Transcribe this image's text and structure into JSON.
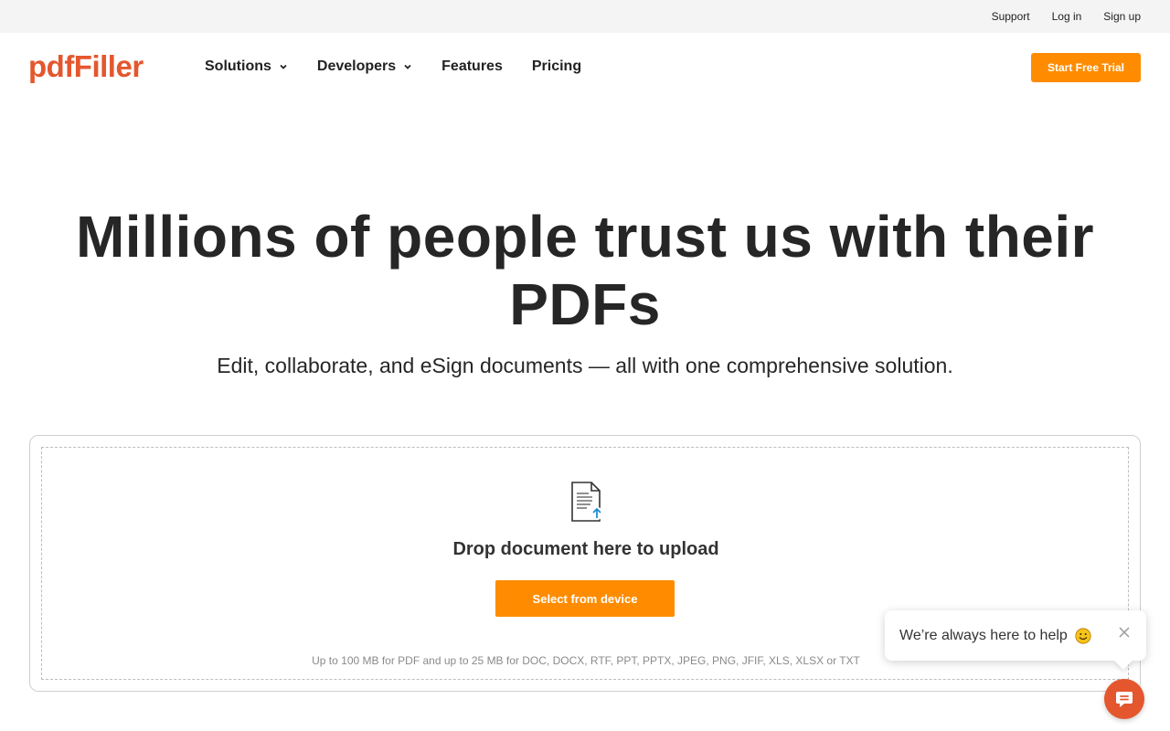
{
  "topbar": {
    "links": [
      "Support",
      "Log in",
      "Sign up"
    ]
  },
  "nav": {
    "logo": "pdfFiller",
    "items": [
      {
        "label": "Solutions",
        "has_dropdown": true
      },
      {
        "label": "Developers",
        "has_dropdown": true
      },
      {
        "label": "Features",
        "has_dropdown": false
      },
      {
        "label": "Pricing",
        "has_dropdown": false
      }
    ],
    "cta_label": "Start Free Trial"
  },
  "hero": {
    "title": "Millions of people trust us with their PDFs",
    "subtitle": "Edit, collaborate, and eSign documents — all with one comprehensive solution."
  },
  "upload": {
    "icon": "document-upload-icon",
    "title": "Drop document here to upload",
    "button_label": "Select from device",
    "limits": "Up to 100 MB for PDF and up to 25 MB for DOC, DOCX, RTF, PPT, PPTX, JPEG, PNG, JFIF, XLS, XLSX or TXT"
  },
  "chat": {
    "message": "We’re always here to help",
    "icons": [
      "smile-emoji-icon",
      "close-icon",
      "chat-icon"
    ]
  },
  "colors": {
    "brand": "#e4572e",
    "accent": "#ff8c00",
    "topbar_bg": "#f4f4f4",
    "text": "#262626"
  }
}
